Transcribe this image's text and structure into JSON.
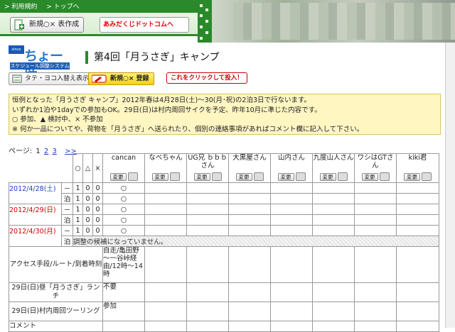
{
  "header": {
    "links": [
      "> 利用規約",
      "> トップへ"
    ],
    "new_button": "新規○× 表作成",
    "banner_link": "あみだくじドットコムへ"
  },
  "logo": {
    "badge": "since 2004",
    "name": "ちょー助",
    "sub": "スケジュール調整システム"
  },
  "page_title": "第4回「月うさぎ」キャンプ",
  "actions": {
    "toggle_label": "タテ・ヨコ入替え表示",
    "entry_label": "新規○× 登録",
    "callout": "これをクリックして投入！"
  },
  "notice": [
    "恒例となった「月うさぎ キャンプ」2012年春は4月28日(土)～30(月･祝)の2泊3日で行ないます。",
    "いずれか1泊や1dayでの参加もOK。29日(日)は村内周回サイクを予定、昨年10月に準じた内容です。",
    "○ 参加、▲ 検討中、× 不参加",
    "※ 何か一品についてや、荷物を「月うさぎ」へ送られたり、個別の連絡事項があればコメント欄に記入して下さい。"
  ],
  "pager": {
    "label": "ページ:",
    "current": "1",
    "pages": [
      "2",
      "3"
    ],
    "next": ">>"
  },
  "table": {
    "sym_headers": [
      "○",
      "△",
      "×"
    ],
    "participants": [
      "cancan",
      "なべちゃん",
      "UG兄 ｂｂｂさん",
      "大黒屋さん",
      "山内さん",
      "九度山人さん",
      "ワシはGTさん",
      "kiki君"
    ],
    "change_label": "変更",
    "rows": [
      {
        "date": "2012/4/28(土)",
        "slot": "－",
        "counts": [
          "1",
          "0",
          "0"
        ],
        "mark": "○",
        "color": "blue"
      },
      {
        "date": "",
        "slot": "泊",
        "counts": [
          "1",
          "0",
          "0"
        ],
        "mark": "○",
        "color": "blue"
      },
      {
        "date": "2012/4/29(日)",
        "slot": "－",
        "counts": [
          "1",
          "0",
          "0"
        ],
        "mark": "○",
        "color": "red"
      },
      {
        "date": "",
        "slot": "泊",
        "counts": [
          "1",
          "0",
          "0"
        ],
        "mark": "○",
        "color": "red"
      },
      {
        "date": "2012/4/30(月)",
        "slot": "－",
        "counts": [
          "1",
          "0",
          "0"
        ],
        "mark": "○",
        "color": "red"
      }
    ],
    "note_row": {
      "slot": "泊",
      "text": "調整の候補になっていません。"
    },
    "questions": [
      {
        "label": "アクセス手段/ルート/到着時刻",
        "answer": "自走/亀田野～一谷峠経由/12時～14時"
      },
      {
        "label": "29日(日)昼「月うさぎ」ランチ",
        "answer": "不要"
      },
      {
        "label": "29日(日)村内周回ツーリング",
        "answer": "参加"
      },
      {
        "label": "コメント",
        "answer": ""
      }
    ]
  }
}
